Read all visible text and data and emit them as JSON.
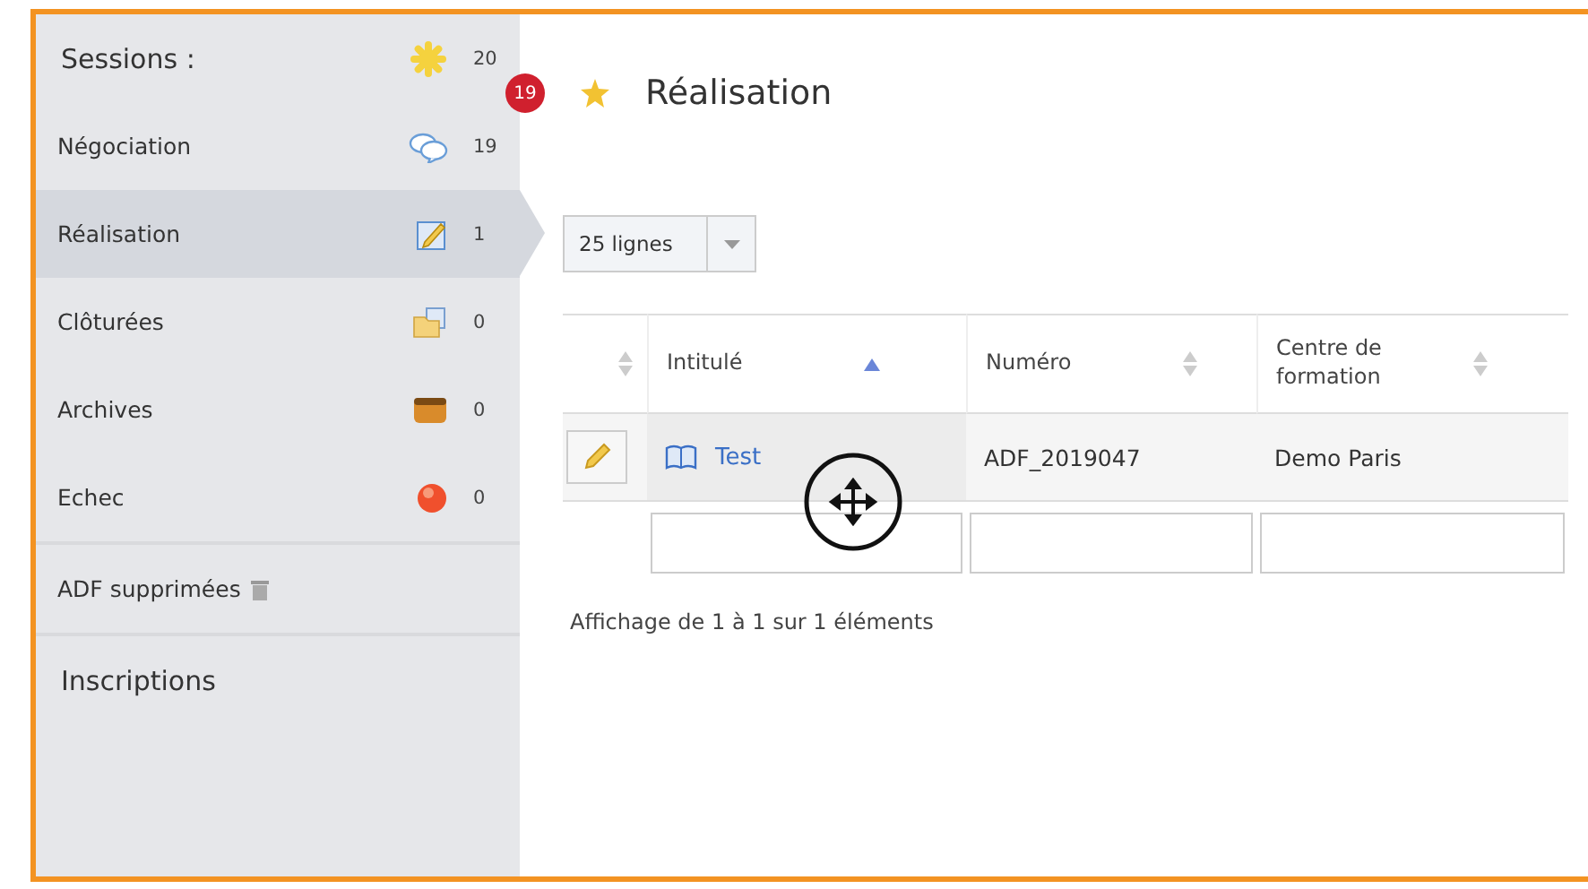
{
  "sidebar": {
    "header": {
      "label": "Sessions :",
      "kind": "sun",
      "count": "20"
    },
    "items": [
      {
        "label": "Négociation",
        "kind": "chat",
        "count": "19",
        "badge": "19",
        "selected": false
      },
      {
        "label": "Réalisation",
        "kind": "edit",
        "count": "1",
        "selected": true
      },
      {
        "label": "Clôturées",
        "kind": "folder",
        "count": "0",
        "selected": false
      },
      {
        "label": "Archives",
        "kind": "box",
        "count": "0",
        "selected": false
      },
      {
        "label": "Echec",
        "kind": "dot",
        "count": "0",
        "selected": false
      }
    ],
    "deleted": {
      "label": "ADF supprimées"
    },
    "section": "Inscriptions"
  },
  "main": {
    "title": "Réalisation",
    "page_size": "25 lignes",
    "table": {
      "columns": [
        {
          "label": "Intitulé",
          "sorted": true
        },
        {
          "label": "Numéro",
          "sorted": false
        },
        {
          "label": "Centre de formation",
          "sorted": false
        }
      ],
      "rows": [
        {
          "title": "Test",
          "number": "ADF_2019047",
          "centre": "Demo Paris"
        }
      ]
    },
    "info": "Affichage de 1 à 1 sur 1 éléments"
  }
}
